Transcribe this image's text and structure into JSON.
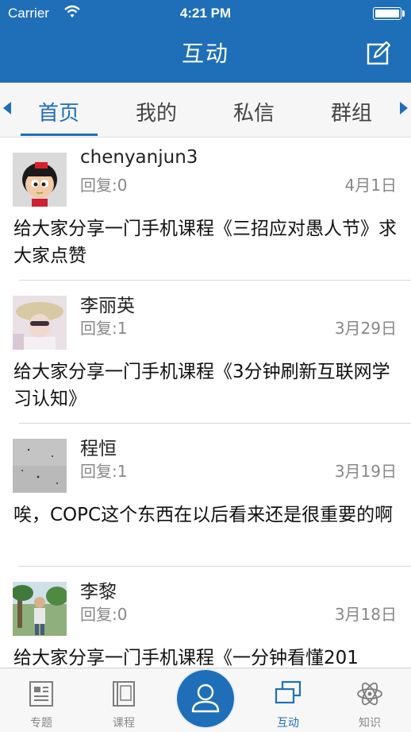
{
  "status": {
    "carrier": "Carrier",
    "time": "4:21 PM"
  },
  "nav": {
    "title": "互动",
    "compose_icon": "compose-icon"
  },
  "tabs": [
    {
      "label": "首页",
      "active": true
    },
    {
      "label": "我的",
      "active": false
    },
    {
      "label": "私信",
      "active": false
    },
    {
      "label": "群组",
      "active": false
    }
  ],
  "posts": [
    {
      "user": "chenyanjun3",
      "reply": "回复:0",
      "date": "4月1日",
      "content": "给大家分享一门手机课程《三招应对愚人节》求大家点赞"
    },
    {
      "user": "李丽英",
      "reply": "回复:1",
      "date": "3月29日",
      "content": "给大家分享一门手机课程《3分钟刷新互联网学习认知》"
    },
    {
      "user": "程恒",
      "reply": "回复:1",
      "date": "3月19日",
      "content": "唉，COPC这个东西在以后看来还是很重要的啊"
    },
    {
      "user": "李黎",
      "reply": "回复:0",
      "date": "3月18日",
      "content": "给大家分享一门手机课程《一分钟看懂201"
    }
  ],
  "bottom_tabs": [
    {
      "label": "专题",
      "icon": "document-icon",
      "active": false
    },
    {
      "label": "课程",
      "icon": "book-icon",
      "active": false
    },
    {
      "label": "",
      "icon": "person-icon",
      "active": false
    },
    {
      "label": "互动",
      "icon": "chat-icon",
      "active": true
    },
    {
      "label": "知识",
      "icon": "atom-icon",
      "active": false
    }
  ],
  "colors": {
    "brand": "#1f6fb8",
    "secondary_text": "#888888"
  }
}
